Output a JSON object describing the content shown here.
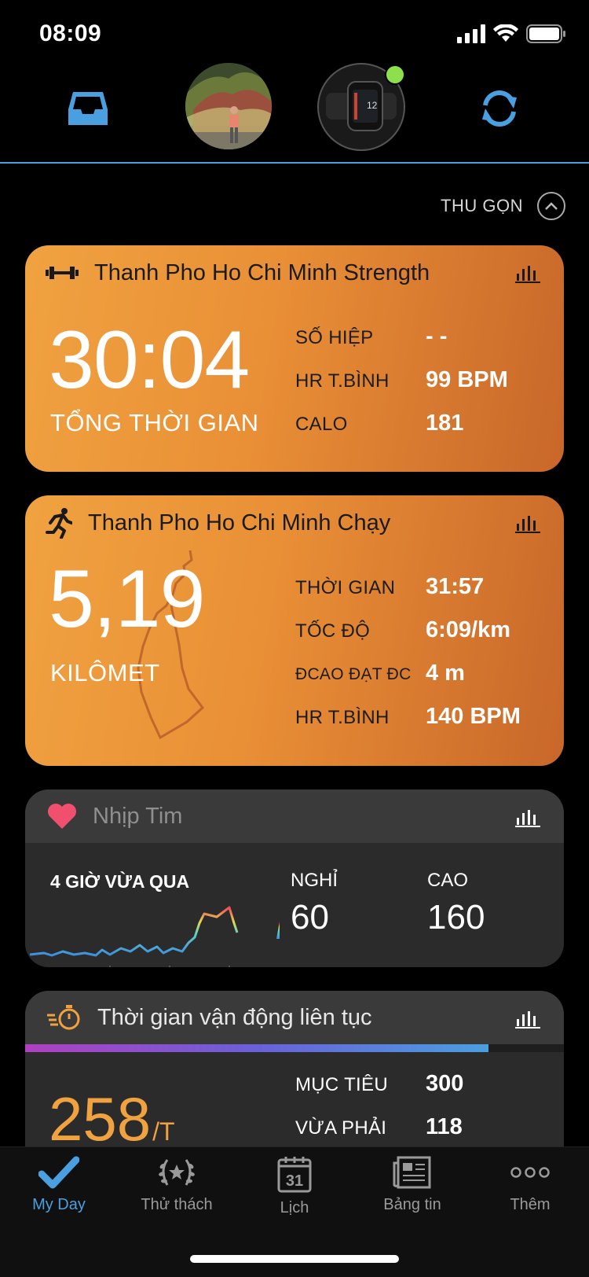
{
  "status_bar": {
    "time": "08:09"
  },
  "header": {
    "inbox_icon": "inbox-icon",
    "sync_icon": "sync-icon",
    "device_status_color": "#8de04b",
    "accent_color": "#4a9fe0"
  },
  "collapse": {
    "label": "THU GỌN"
  },
  "strength_card": {
    "title": "Thanh Pho Ho Chi Minh Strength",
    "main_value": "30:04",
    "main_label": "TỔNG THỜI GIAN",
    "stats": [
      {
        "label": "SỐ HIỆP",
        "value": "- -"
      },
      {
        "label": "HR T.BÌNH",
        "value": "99 BPM"
      },
      {
        "label": "CALO",
        "value": "181"
      }
    ]
  },
  "run_card": {
    "title": "Thanh Pho Ho Chi Minh Chạy",
    "main_value": "5,19",
    "main_label": "KILÔMET",
    "stats": [
      {
        "label": "THỜI GIAN",
        "value": "31:57"
      },
      {
        "label": "TỐC ĐỘ",
        "value": "6:09/km"
      },
      {
        "label": "ĐCAO ĐẠT ĐC",
        "value": "4 m"
      },
      {
        "label": "HR T.BÌNH",
        "value": "140 BPM"
      }
    ]
  },
  "heart_card": {
    "title": "Nhịp Tim",
    "period": "4 GIỜ VỪA QUA",
    "rest_label": "NGHỈ",
    "rest_value": "60",
    "high_label": "CAO",
    "high_value": "160"
  },
  "active_card": {
    "title": "Thời gian vận động liên tục",
    "value": "258",
    "unit": "/T",
    "progress": 0.86,
    "stats": [
      {
        "label": "MỤC TIÊU",
        "value": "300"
      },
      {
        "label": "VỪA PHẢI",
        "value": "118"
      }
    ]
  },
  "tabs": [
    {
      "label": "My Day",
      "icon": "checkmark-icon",
      "active": true
    },
    {
      "label": "Thử thách",
      "icon": "laurel-icon",
      "active": false
    },
    {
      "label": "Lịch",
      "icon": "calendar-icon",
      "active": false,
      "calendar_day": "31"
    },
    {
      "label": "Bảng tin",
      "icon": "newsfeed-icon",
      "active": false
    },
    {
      "label": "Thêm",
      "icon": "more-dots-icon",
      "active": false
    }
  ]
}
